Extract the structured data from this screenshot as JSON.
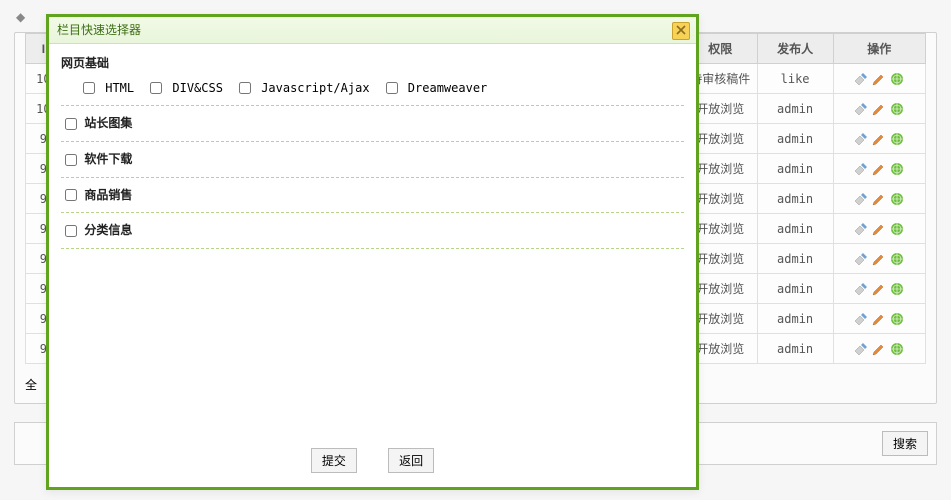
{
  "crumb": {
    "marker": "◆"
  },
  "table": {
    "headers": {
      "id": "I",
      "perm": "权限",
      "publisher": "发布人",
      "actions": "操作"
    },
    "rows": [
      {
        "id": "10",
        "perm": "待审核稿件",
        "publisher": "like"
      },
      {
        "id": "10",
        "perm": "开放浏览",
        "publisher": "admin"
      },
      {
        "id": "9",
        "perm": "开放浏览",
        "publisher": "admin"
      },
      {
        "id": "9",
        "perm": "开放浏览",
        "publisher": "admin"
      },
      {
        "id": "9",
        "perm": "开放浏览",
        "publisher": "admin"
      },
      {
        "id": "9",
        "perm": "开放浏览",
        "publisher": "admin"
      },
      {
        "id": "9",
        "perm": "开放浏览",
        "publisher": "admin"
      },
      {
        "id": "9",
        "perm": "开放浏览",
        "publisher": "admin"
      },
      {
        "id": "9",
        "perm": "开放浏览",
        "publisher": "admin"
      },
      {
        "id": "9",
        "perm": "开放浏览",
        "publisher": "admin"
      }
    ],
    "footer_left": "全"
  },
  "search": {
    "label": "搜索"
  },
  "modal": {
    "title": "栏目快速选择器",
    "head1": "网页基础",
    "subs": [
      "HTML",
      "DIV&CSS",
      "Javascript/Ajax",
      "Dreamweaver"
    ],
    "rows": [
      "站长图集",
      "软件下载",
      "商品销售",
      "分类信息"
    ],
    "submit": "提交",
    "back": "返回"
  }
}
